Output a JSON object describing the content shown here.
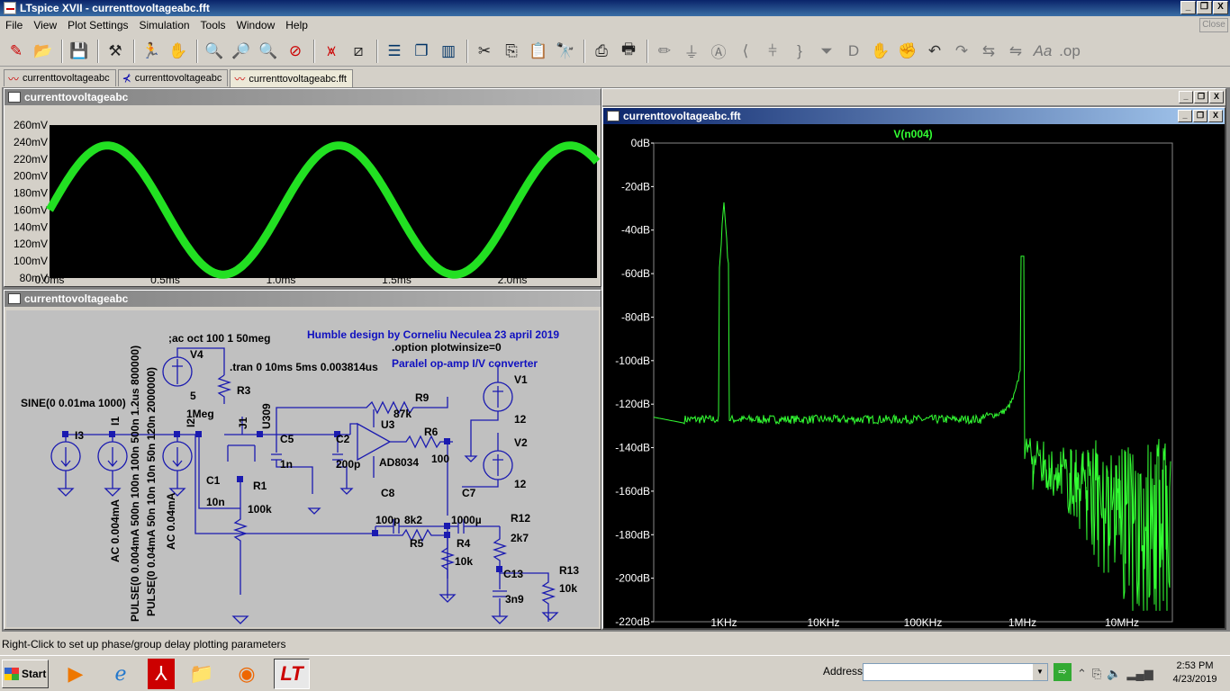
{
  "window": {
    "title": "LTspice XVII - currenttovoltageabc.fft",
    "min": "_",
    "restore": "❐",
    "close": "X"
  },
  "menu": [
    "File",
    "View",
    "Plot Settings",
    "Simulation",
    "Tools",
    "Window",
    "Help"
  ],
  "close_box": "Close",
  "toolbar_icons": [
    "new-schematic-icon",
    "open-icon",
    "save-icon",
    "control-panel-icon",
    "run-icon",
    "pan-icon",
    "zoom-in-icon",
    "zoom-area-icon",
    "zoom-out-icon",
    "zoom-cancel-icon",
    "autorange-icon",
    "zoom-full-icon",
    "tile-horizontal-icon",
    "cascade-icon",
    "tile-vertical-icon",
    "cut-icon",
    "copy-icon",
    "paste-icon",
    "find-icon",
    "print-icon",
    "print-setup-icon",
    "wire-icon",
    "ground-icon",
    "label-icon",
    "resistor-icon",
    "capacitor-icon",
    "inductor-icon",
    "diode-icon",
    "component-icon",
    "move-icon",
    "drag-icon",
    "undo-icon",
    "redo-icon",
    "rotate-icon",
    "mirror-icon",
    "text-icon",
    "spice-directive-icon"
  ],
  "tabs": [
    {
      "label": "currenttovoltageabc",
      "icon": "waveform-icon"
    },
    {
      "label": "currenttovoltageabc",
      "icon": "schematic-icon"
    },
    {
      "label": "currenttovoltageabc.fft",
      "icon": "waveform-icon"
    }
  ],
  "waveform_panel": {
    "title": "currenttovoltageabc",
    "y_ticks": [
      "260mV",
      "240mV",
      "220mV",
      "200mV",
      "180mV",
      "160mV",
      "140mV",
      "120mV",
      "100mV",
      "80mV"
    ],
    "x_ticks": [
      "0.0ms",
      "0.5ms",
      "1.0ms",
      "1.5ms",
      "2.0ms"
    ]
  },
  "schematic_panel": {
    "title": "currenttovoltageabc",
    "labels": {
      "credit": "Humble design by Corneliu Neculea 23 april 2019",
      "option": ".option plotwinsize=0",
      "converter": "Paralel op-amp I/V converter",
      "ac_cmd": ";ac oct 100 1 50meg",
      "tran_cmd": ".tran 0 10ms 5ms 0.003814us",
      "v4": "V4",
      "v4_val": "5",
      "r3": "R3",
      "r3_val": "1Meg",
      "sine": "SINE(0 0.01ma 1000)",
      "i3": "I3",
      "i1": "I1",
      "i2": "I2",
      "i1_pulse": "PULSE(0 0.004mA 500n 100n 100n 500n 1.2us 800000)",
      "i1_ac": "AC 0.004mA",
      "i2_pulse": "PULSE(0 0.04mA 50n 10n 10n 50n 120n 2000000)",
      "i2_ac": "AC 0.04mA",
      "j1": "J1",
      "u309": "U309",
      "c5": "C5",
      "c5_val": "1n",
      "c2": "C2",
      "c2_val": "200p",
      "c1": "C1",
      "c1_val": "10n",
      "r1": "R1",
      "r1_val": "100k",
      "r9": "R9",
      "r9_val": "87k",
      "u3": "U3",
      "u3_val": "AD8034",
      "r6": "R6",
      "r6_val": "100",
      "v1": "V1",
      "v1_val": "12",
      "v2": "V2",
      "v2_val": "12",
      "c8": "C8",
      "c8_val": "100p",
      "r5": "R5",
      "r5_val": "8k2",
      "c7": "C7",
      "c7_val": "1000µ",
      "r4": "R4",
      "r4_val": "10k",
      "r12": "R12",
      "r12_val": "2k7",
      "c13": "C13",
      "c13_val": "3n9",
      "r13": "R13",
      "r13_val": "10k"
    }
  },
  "fft_panel": {
    "title": "currenttovoltageabc.fft",
    "trace_name": "V(n004)",
    "trace_color": "#33ff33",
    "y_ticks": [
      "0dB",
      "-20dB",
      "-40dB",
      "-60dB",
      "-80dB",
      "-100dB",
      "-120dB",
      "-140dB",
      "-160dB",
      "-180dB",
      "-200dB",
      "-220dB"
    ],
    "x_ticks": [
      "1KHz",
      "10KHz",
      "100KHz",
      "1MHz",
      "10MHz"
    ]
  },
  "status": "Right-Click to set up phase/group delay plotting parameters",
  "taskbar": {
    "start": "Start",
    "address_label": "Address",
    "address_value": "",
    "go": "⇨",
    "time": "2:53 PM",
    "date": "4/23/2019"
  }
}
